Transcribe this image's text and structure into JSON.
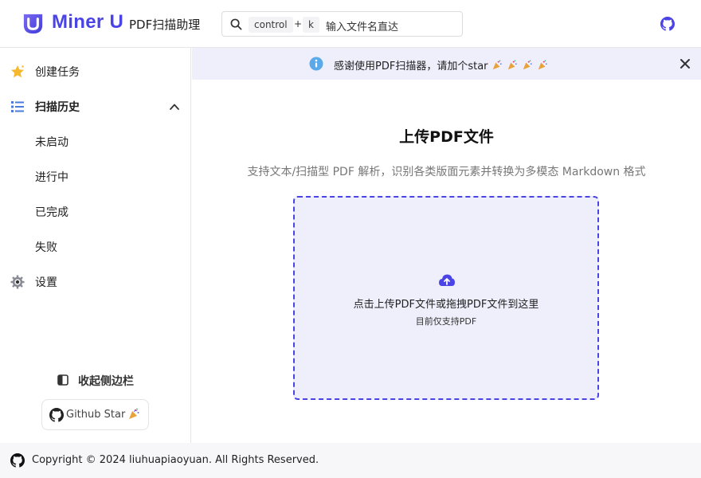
{
  "header": {
    "brand": "Miner U",
    "subtitle": "PDF扫描助理",
    "search": {
      "key1": "control",
      "plus": "+",
      "key2": "k",
      "placeholder": "输入文件名直达"
    }
  },
  "sidebar": {
    "items": [
      {
        "label": "创建任务",
        "icon": "star-icon"
      },
      {
        "label": "扫描历史",
        "icon": "list-icon"
      },
      {
        "label": "设置",
        "icon": "gear-icon"
      }
    ],
    "history_sub": [
      "未启动",
      "进行中",
      "已完成",
      "失败"
    ],
    "collapse_label": "收起侧边栏",
    "github_star_label": "Github Star"
  },
  "banner": {
    "message": "感谢使用PDF扫描器，请加个star"
  },
  "main": {
    "title": "上传PDF文件",
    "description": "支持文本/扫描型 PDF 解析，识别各类版面元素并转换为多模态 Markdown 格式",
    "dropzone_title": "点击上传PDF文件或拖拽PDF文件到这里",
    "dropzone_sub": "目前仅支持PDF"
  },
  "footer": {
    "copyright": "Copyright © 2024 liuhuapiaoyuan. All Rights Reserved."
  },
  "colors": {
    "accent": "#4a44e6",
    "banner_bg": "#efeffc",
    "info_blue": "#5aa9e8"
  }
}
